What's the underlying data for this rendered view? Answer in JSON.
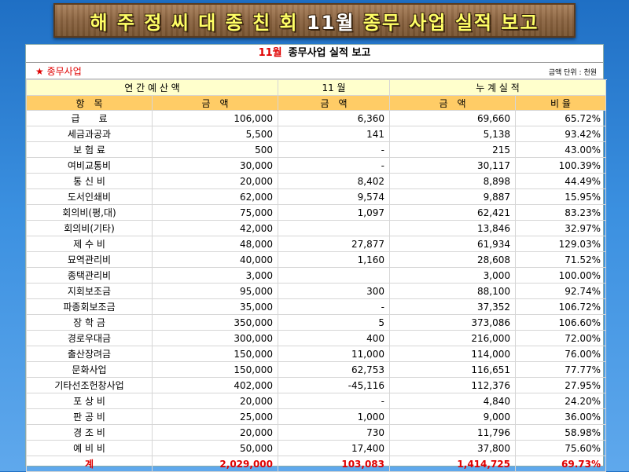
{
  "banner": {
    "title_part1": "해 주 정 씨 대 종 친 회 ",
    "title_highlight": "11월",
    "title_part2": " 종무 사업 실적 보고"
  },
  "report": {
    "month": "11월",
    "title": "종무사업 실적 보고",
    "section": "★ 종무사업",
    "unit": "금액 단위 : 천원"
  },
  "headers": {
    "annual_budget": "연 간 예 산 액",
    "month": "11 월",
    "cumulative": "누 계 실 적",
    "item": "항　목",
    "amount": "금　액",
    "ratio": "비 율"
  },
  "rows": [
    {
      "name": "급　　료",
      "budget": "106,000",
      "month": "6,360",
      "cumulative": "69,660",
      "ratio": "65.72%"
    },
    {
      "name": "세금과공과",
      "budget": "5,500",
      "month": "141",
      "cumulative": "5,138",
      "ratio": "93.42%"
    },
    {
      "name": "보 험 료",
      "budget": "500",
      "month": "-",
      "cumulative": "215",
      "ratio": "43.00%"
    },
    {
      "name": "여비교통비",
      "budget": "30,000",
      "month": "-",
      "cumulative": "30,117",
      "ratio": "100.39%"
    },
    {
      "name": "통 신 비",
      "budget": "20,000",
      "month": "8,402",
      "cumulative": "8,898",
      "ratio": "44.49%"
    },
    {
      "name": "도서인쇄비",
      "budget": "62,000",
      "month": "9,574",
      "cumulative": "9,887",
      "ratio": "15.95%"
    },
    {
      "name": "회의비(평,대)",
      "budget": "75,000",
      "month": "1,097",
      "cumulative": "62,421",
      "ratio": "83.23%"
    },
    {
      "name": "회의비(기타)",
      "budget": "42,000",
      "month": "",
      "cumulative": "13,846",
      "ratio": "32.97%"
    },
    {
      "name": "제 수 비",
      "budget": "48,000",
      "month": "27,877",
      "cumulative": "61,934",
      "ratio": "129.03%"
    },
    {
      "name": "묘역관리비",
      "budget": "40,000",
      "month": "1,160",
      "cumulative": "28,608",
      "ratio": "71.52%"
    },
    {
      "name": "종택관리비",
      "budget": "3,000",
      "month": "",
      "cumulative": "3,000",
      "ratio": "100.00%"
    },
    {
      "name": "지회보조금",
      "budget": "95,000",
      "month": "300",
      "cumulative": "88,100",
      "ratio": "92.74%"
    },
    {
      "name": "파종회보조금",
      "budget": "35,000",
      "month": "-",
      "cumulative": "37,352",
      "ratio": "106.72%"
    },
    {
      "name": "장 학 금",
      "budget": "350,000",
      "month": "5",
      "cumulative": "373,086",
      "ratio": "106.60%"
    },
    {
      "name": "경로우대금",
      "budget": "300,000",
      "month": "400",
      "cumulative": "216,000",
      "ratio": "72.00%"
    },
    {
      "name": "출산장려금",
      "budget": "150,000",
      "month": "11,000",
      "cumulative": "114,000",
      "ratio": "76.00%"
    },
    {
      "name": "문화사업",
      "budget": "150,000",
      "month": "62,753",
      "cumulative": "116,651",
      "ratio": "77.77%"
    },
    {
      "name": "기타선조헌창사업",
      "budget": "402,000",
      "month": "-45,116",
      "cumulative": "112,376",
      "ratio": "27.95%"
    },
    {
      "name": "포 상 비",
      "budget": "20,000",
      "month": "-",
      "cumulative": "4,840",
      "ratio": "24.20%"
    },
    {
      "name": "판 공 비",
      "budget": "25,000",
      "month": "1,000",
      "cumulative": "9,000",
      "ratio": "36.00%"
    },
    {
      "name": "경 조 비",
      "budget": "20,000",
      "month": "730",
      "cumulative": "11,796",
      "ratio": "58.98%"
    },
    {
      "name": "예 비 비",
      "budget": "50,000",
      "month": "17,400",
      "cumulative": "37,800",
      "ratio": "75.60%"
    }
  ],
  "total": {
    "name": "계",
    "budget": "2,029,000",
    "month": "103,083",
    "cumulative": "1,414,725",
    "ratio": "69.73%"
  }
}
